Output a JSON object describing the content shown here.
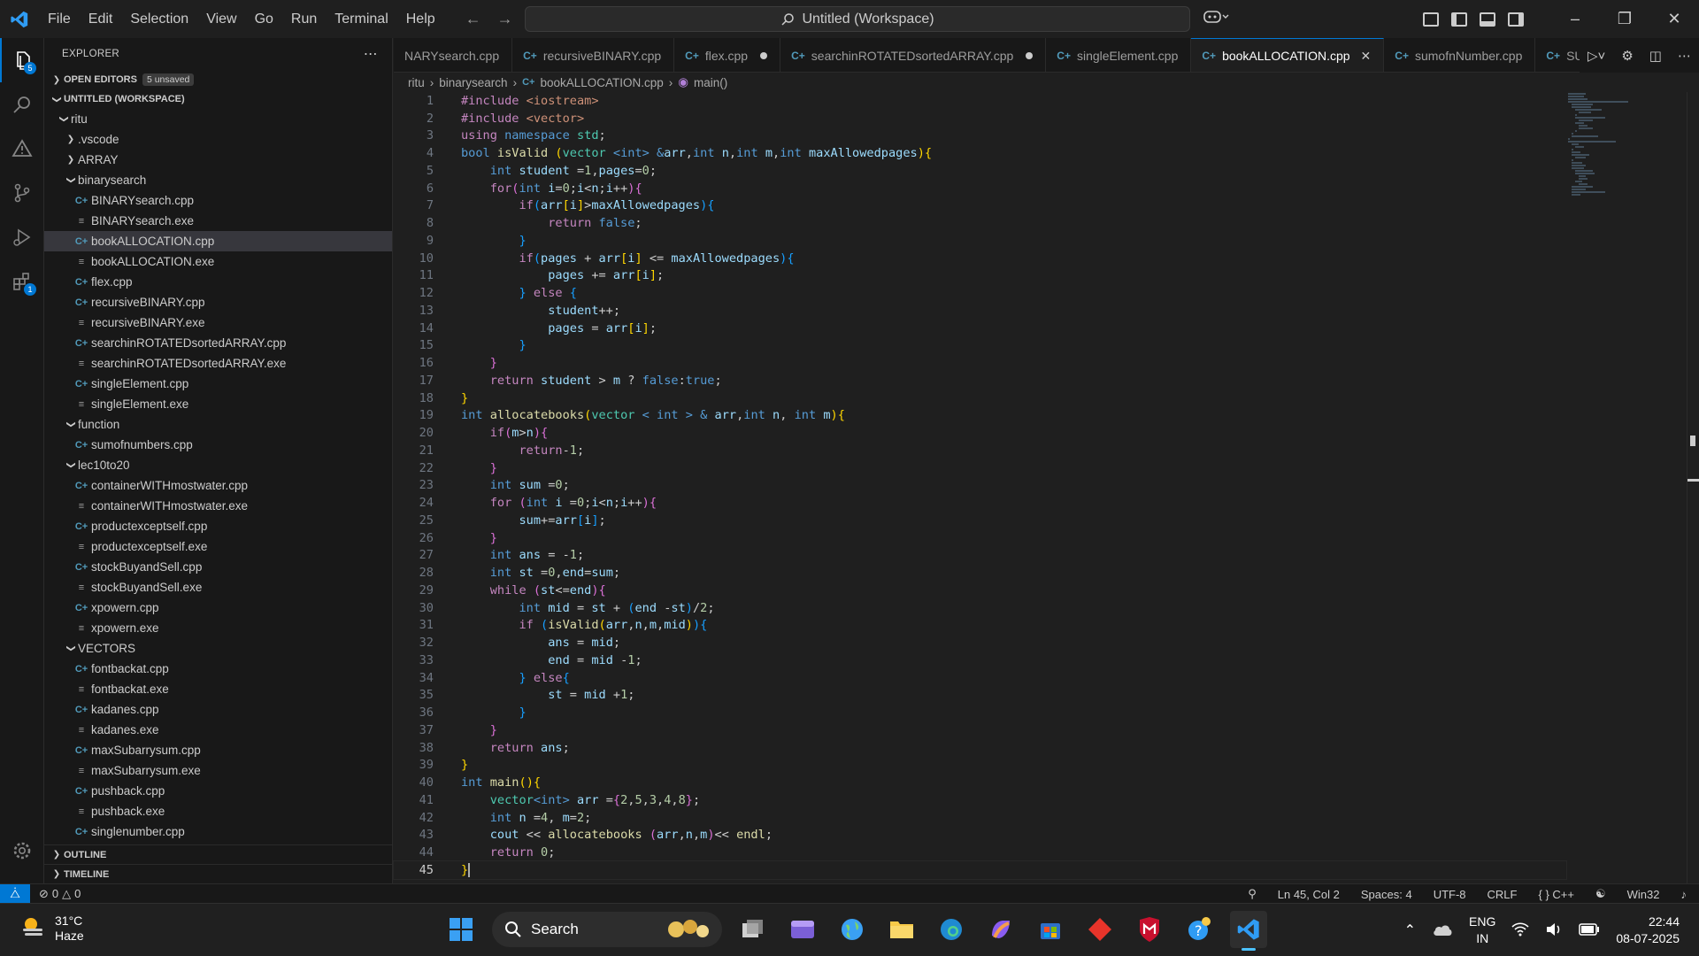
{
  "menu": [
    "File",
    "Edit",
    "Selection",
    "View",
    "Go",
    "Run",
    "Terminal",
    "Help"
  ],
  "command_center": "Untitled (Workspace)",
  "explorer": {
    "title": "EXPLORER",
    "open_editors": "OPEN EDITORS",
    "unsaved_badge": "5 unsaved",
    "workspace": "UNTITLED (WORKSPACE)",
    "outline": "OUTLINE",
    "timeline": "TIMELINE"
  },
  "tree": [
    {
      "label": "ritu",
      "type": "folder-open",
      "depth": 1
    },
    {
      "label": ".vscode",
      "type": "folder",
      "depth": 2
    },
    {
      "label": "ARRAY",
      "type": "folder",
      "depth": 2
    },
    {
      "label": "binarysearch",
      "type": "folder-open",
      "depth": 2
    },
    {
      "label": "BINARYsearch.cpp",
      "type": "cpp",
      "depth": 3
    },
    {
      "label": "BINARYsearch.exe",
      "type": "exe",
      "depth": 3
    },
    {
      "label": "bookALLOCATION.cpp",
      "type": "cpp",
      "depth": 3,
      "selected": true
    },
    {
      "label": "bookALLOCATION.exe",
      "type": "exe",
      "depth": 3
    },
    {
      "label": "flex.cpp",
      "type": "cpp",
      "depth": 3
    },
    {
      "label": "recursiveBINARY.cpp",
      "type": "cpp",
      "depth": 3
    },
    {
      "label": "recursiveBINARY.exe",
      "type": "exe",
      "depth": 3
    },
    {
      "label": "searchinROTATEDsortedARRAY.cpp",
      "type": "cpp",
      "depth": 3
    },
    {
      "label": "searchinROTATEDsortedARRAY.exe",
      "type": "exe",
      "depth": 3
    },
    {
      "label": "singleElement.cpp",
      "type": "cpp",
      "depth": 3
    },
    {
      "label": "singleElement.exe",
      "type": "exe",
      "depth": 3
    },
    {
      "label": "function",
      "type": "folder-open",
      "depth": 2
    },
    {
      "label": "sumofnumbers.cpp",
      "type": "cpp",
      "depth": 3
    },
    {
      "label": "lec10to20",
      "type": "folder-open",
      "depth": 2
    },
    {
      "label": "containerWITHmostwater.cpp",
      "type": "cpp",
      "depth": 3
    },
    {
      "label": "containerWITHmostwater.exe",
      "type": "exe",
      "depth": 3
    },
    {
      "label": "productexceptself.cpp",
      "type": "cpp",
      "depth": 3
    },
    {
      "label": "productexceptself.exe",
      "type": "exe",
      "depth": 3
    },
    {
      "label": "stockBuyandSell.cpp",
      "type": "cpp",
      "depth": 3
    },
    {
      "label": "stockBuyandSell.exe",
      "type": "exe",
      "depth": 3
    },
    {
      "label": "xpowern.cpp",
      "type": "cpp",
      "depth": 3
    },
    {
      "label": "xpowern.exe",
      "type": "exe",
      "depth": 3
    },
    {
      "label": "VECTORS",
      "type": "folder-open",
      "depth": 2
    },
    {
      "label": "fontbackat.cpp",
      "type": "cpp",
      "depth": 3
    },
    {
      "label": "fontbackat.exe",
      "type": "exe",
      "depth": 3
    },
    {
      "label": "kadanes.cpp",
      "type": "cpp",
      "depth": 3
    },
    {
      "label": "kadanes.exe",
      "type": "exe",
      "depth": 3
    },
    {
      "label": "maxSubarrysum.cpp",
      "type": "cpp",
      "depth": 3
    },
    {
      "label": "maxSubarrysum.exe",
      "type": "exe",
      "depth": 3
    },
    {
      "label": "pushback.cpp",
      "type": "cpp",
      "depth": 3
    },
    {
      "label": "pushback.exe",
      "type": "exe",
      "depth": 3
    },
    {
      "label": "singlenumber.cpp",
      "type": "cpp",
      "depth": 3
    }
  ],
  "tabs": [
    {
      "label": "NARYsearch.cpp",
      "dirty": false,
      "active": false
    },
    {
      "label": "recursiveBINARY.cpp",
      "dirty": false,
      "active": false
    },
    {
      "label": "flex.cpp",
      "dirty": true,
      "active": false
    },
    {
      "label": "searchinROTATEDsortedARRAY.cpp",
      "dirty": true,
      "active": false
    },
    {
      "label": "singleElement.cpp",
      "dirty": false,
      "active": false
    },
    {
      "label": "bookALLOCATION.cpp",
      "dirty": false,
      "active": true
    },
    {
      "label": "sumofnNumber.cpp",
      "dirty": false,
      "active": false
    },
    {
      "label": "SUMpas",
      "dirty": false,
      "active": false
    }
  ],
  "breadcrumb": {
    "root": "ritu",
    "folder": "binarysearch",
    "file": "bookALLOCATION.cpp",
    "symbol": "main()"
  },
  "code": [
    [
      [
        "#include ",
        "ctl"
      ],
      [
        "<iostream>",
        "str"
      ]
    ],
    [
      [
        "#include ",
        "ctl"
      ],
      [
        "<vector>",
        "str"
      ]
    ],
    [
      [
        "using ",
        "ctl"
      ],
      [
        "namespace ",
        "kw"
      ],
      [
        "std",
        "typ"
      ],
      [
        ";",
        ""
      ]
    ],
    [
      [
        "bool ",
        "kw"
      ],
      [
        "isValid ",
        "fn"
      ],
      [
        "(",
        "b1"
      ],
      [
        "vector ",
        "typ"
      ],
      [
        "<",
        "kw"
      ],
      [
        "int",
        "kw"
      ],
      [
        "> ",
        "kw"
      ],
      [
        "&",
        "kw"
      ],
      [
        "arr",
        "var"
      ],
      [
        ",",
        ""
      ],
      [
        "int ",
        "kw"
      ],
      [
        "n",
        "var"
      ],
      [
        ",",
        ""
      ],
      [
        "int ",
        "kw"
      ],
      [
        "m",
        "var"
      ],
      [
        ",",
        ""
      ],
      [
        "int ",
        "kw"
      ],
      [
        "maxAllowedpages",
        "var"
      ],
      [
        ")",
        "b1"
      ],
      [
        "{",
        "b1"
      ]
    ],
    [
      [
        "    int ",
        "kw"
      ],
      [
        "student ",
        "var"
      ],
      [
        "=",
        ""
      ],
      [
        "1",
        "num"
      ],
      [
        ",",
        ""
      ],
      [
        "pages",
        "var"
      ],
      [
        "=",
        ""
      ],
      [
        "0",
        "num"
      ],
      [
        ";",
        ""
      ]
    ],
    [
      [
        "    for",
        "ctl"
      ],
      [
        "(",
        "b2"
      ],
      [
        "int ",
        "kw"
      ],
      [
        "i",
        "var"
      ],
      [
        "=",
        ""
      ],
      [
        "0",
        "num"
      ],
      [
        ";",
        ""
      ],
      [
        "i",
        "var"
      ],
      [
        "<",
        ""
      ],
      [
        "n",
        "var"
      ],
      [
        ";",
        ""
      ],
      [
        "i",
        "var"
      ],
      [
        "++",
        ""
      ],
      [
        ")",
        "b2"
      ],
      [
        "{",
        "b2"
      ]
    ],
    [
      [
        "        if",
        "ctl"
      ],
      [
        "(",
        "b3"
      ],
      [
        "arr",
        "var"
      ],
      [
        "[",
        "b1"
      ],
      [
        "i",
        "var"
      ],
      [
        "]",
        "b1"
      ],
      [
        ">",
        ""
      ],
      [
        "maxAllowedpages",
        "var"
      ],
      [
        ")",
        "b3"
      ],
      [
        "{",
        "b3"
      ]
    ],
    [
      [
        "            return ",
        "ctl"
      ],
      [
        "false",
        "kw"
      ],
      [
        ";",
        ""
      ]
    ],
    [
      [
        "        }",
        "b3"
      ]
    ],
    [
      [
        "        if",
        "ctl"
      ],
      [
        "(",
        "b3"
      ],
      [
        "pages ",
        "var"
      ],
      [
        "+ ",
        ""
      ],
      [
        "arr",
        "var"
      ],
      [
        "[",
        "b1"
      ],
      [
        "i",
        "var"
      ],
      [
        "]",
        "b1"
      ],
      [
        " <= ",
        ""
      ],
      [
        "maxAllowedpages",
        "var"
      ],
      [
        ")",
        "b3"
      ],
      [
        "{",
        "b3"
      ]
    ],
    [
      [
        "            pages ",
        "var"
      ],
      [
        "+= ",
        ""
      ],
      [
        "arr",
        "var"
      ],
      [
        "[",
        "b1"
      ],
      [
        "i",
        "var"
      ],
      [
        "]",
        "b1"
      ],
      [
        ";",
        ""
      ]
    ],
    [
      [
        "        } ",
        "b3"
      ],
      [
        "else ",
        "ctl"
      ],
      [
        "{",
        "b3"
      ]
    ],
    [
      [
        "            student",
        "var"
      ],
      [
        "++;",
        ""
      ]
    ],
    [
      [
        "            pages ",
        "var"
      ],
      [
        "= ",
        ""
      ],
      [
        "arr",
        "var"
      ],
      [
        "[",
        "b1"
      ],
      [
        "i",
        "var"
      ],
      [
        "]",
        "b1"
      ],
      [
        ";",
        ""
      ]
    ],
    [
      [
        "        }",
        "b3"
      ]
    ],
    [
      [
        "    }",
        "b2"
      ]
    ],
    [
      [
        "    return ",
        "ctl"
      ],
      [
        "student ",
        "var"
      ],
      [
        "> ",
        ""
      ],
      [
        "m ",
        "var"
      ],
      [
        "? ",
        ""
      ],
      [
        "false",
        "kw"
      ],
      [
        ":",
        ""
      ],
      [
        "true",
        "kw"
      ],
      [
        ";",
        ""
      ]
    ],
    [
      [
        "}",
        "b1"
      ]
    ],
    [
      [
        "int ",
        "kw"
      ],
      [
        "allocatebooks",
        "fn"
      ],
      [
        "(",
        "b1"
      ],
      [
        "vector ",
        "typ"
      ],
      [
        "< ",
        "kw"
      ],
      [
        "int ",
        "kw"
      ],
      [
        "> ",
        "kw"
      ],
      [
        "& ",
        "kw"
      ],
      [
        "arr",
        "var"
      ],
      [
        ",",
        ""
      ],
      [
        "int ",
        "kw"
      ],
      [
        "n",
        "var"
      ],
      [
        ", ",
        ""
      ],
      [
        "int ",
        "kw"
      ],
      [
        "m",
        "var"
      ],
      [
        ")",
        "b1"
      ],
      [
        "{",
        "b1"
      ]
    ],
    [
      [
        "    if",
        "ctl"
      ],
      [
        "(",
        "b2"
      ],
      [
        "m",
        "var"
      ],
      [
        ">",
        ""
      ],
      [
        "n",
        "var"
      ],
      [
        ")",
        "b2"
      ],
      [
        "{",
        "b2"
      ]
    ],
    [
      [
        "        return",
        "ctl"
      ],
      [
        "-",
        ""
      ],
      [
        "1",
        "num"
      ],
      [
        ";",
        ""
      ]
    ],
    [
      [
        "    }",
        "b2"
      ]
    ],
    [
      [
        "    int ",
        "kw"
      ],
      [
        "sum ",
        "var"
      ],
      [
        "=",
        ""
      ],
      [
        "0",
        "num"
      ],
      [
        ";",
        ""
      ]
    ],
    [
      [
        "    for ",
        "ctl"
      ],
      [
        "(",
        "b2"
      ],
      [
        "int ",
        "kw"
      ],
      [
        "i ",
        "var"
      ],
      [
        "=",
        ""
      ],
      [
        "0",
        "num"
      ],
      [
        ";",
        ""
      ],
      [
        "i",
        "var"
      ],
      [
        "<",
        ""
      ],
      [
        "n",
        "var"
      ],
      [
        ";",
        ""
      ],
      [
        "i",
        "var"
      ],
      [
        "++",
        ""
      ],
      [
        ")",
        "b2"
      ],
      [
        "{",
        "b2"
      ]
    ],
    [
      [
        "        sum",
        "var"
      ],
      [
        "+=",
        ""
      ],
      [
        "arr",
        "var"
      ],
      [
        "[",
        "b3"
      ],
      [
        "i",
        "var"
      ],
      [
        "]",
        "b3"
      ],
      [
        ";",
        ""
      ]
    ],
    [
      [
        "    }",
        "b2"
      ]
    ],
    [
      [
        "    int ",
        "kw"
      ],
      [
        "ans ",
        "var"
      ],
      [
        "= -",
        ""
      ],
      [
        "1",
        "num"
      ],
      [
        ";",
        ""
      ]
    ],
    [
      [
        "    int ",
        "kw"
      ],
      [
        "st ",
        "var"
      ],
      [
        "=",
        ""
      ],
      [
        "0",
        "num"
      ],
      [
        ",",
        ""
      ],
      [
        "end",
        "var"
      ],
      [
        "=",
        ""
      ],
      [
        "sum",
        "var"
      ],
      [
        ";",
        ""
      ]
    ],
    [
      [
        "    while ",
        "ctl"
      ],
      [
        "(",
        "b2"
      ],
      [
        "st",
        "var"
      ],
      [
        "<=",
        ""
      ],
      [
        "end",
        "var"
      ],
      [
        ")",
        "b2"
      ],
      [
        "{",
        "b2"
      ]
    ],
    [
      [
        "        int ",
        "kw"
      ],
      [
        "mid ",
        "var"
      ],
      [
        "= ",
        ""
      ],
      [
        "st ",
        "var"
      ],
      [
        "+ ",
        ""
      ],
      [
        "(",
        "b3"
      ],
      [
        "end ",
        "var"
      ],
      [
        "-",
        ""
      ],
      [
        "st",
        "var"
      ],
      [
        ")",
        "b3"
      ],
      [
        "/",
        ""
      ],
      [
        "2",
        "num"
      ],
      [
        ";",
        ""
      ]
    ],
    [
      [
        "        if ",
        "ctl"
      ],
      [
        "(",
        "b3"
      ],
      [
        "isValid",
        "fn"
      ],
      [
        "(",
        "b1"
      ],
      [
        "arr",
        "var"
      ],
      [
        ",",
        ""
      ],
      [
        "n",
        "var"
      ],
      [
        ",",
        ""
      ],
      [
        "m",
        "var"
      ],
      [
        ",",
        ""
      ],
      [
        "mid",
        "var"
      ],
      [
        ")",
        "b1"
      ],
      [
        ")",
        "b3"
      ],
      [
        "{",
        "b3"
      ]
    ],
    [
      [
        "            ans ",
        "var"
      ],
      [
        "= ",
        ""
      ],
      [
        "mid",
        "var"
      ],
      [
        ";",
        ""
      ]
    ],
    [
      [
        "            end ",
        "var"
      ],
      [
        "= ",
        ""
      ],
      [
        "mid ",
        "var"
      ],
      [
        "-",
        ""
      ],
      [
        "1",
        "num"
      ],
      [
        ";",
        ""
      ]
    ],
    [
      [
        "        } ",
        "b3"
      ],
      [
        "else",
        "ctl"
      ],
      [
        "{",
        "b3"
      ]
    ],
    [
      [
        "            st ",
        "var"
      ],
      [
        "= ",
        ""
      ],
      [
        "mid ",
        "var"
      ],
      [
        "+",
        ""
      ],
      [
        "1",
        "num"
      ],
      [
        ";",
        ""
      ]
    ],
    [
      [
        "        }",
        "b3"
      ]
    ],
    [
      [
        "    }",
        "b2"
      ]
    ],
    [
      [
        "    return ",
        "ctl"
      ],
      [
        "ans",
        "var"
      ],
      [
        ";",
        ""
      ]
    ],
    [
      [
        "}",
        "b1"
      ]
    ],
    [
      [
        "int ",
        "kw"
      ],
      [
        "main",
        "fn"
      ],
      [
        "(",
        "b1"
      ],
      [
        ")",
        "b1"
      ],
      [
        "{",
        "b1"
      ]
    ],
    [
      [
        "    vector",
        "typ"
      ],
      [
        "<",
        "kw"
      ],
      [
        "int",
        "kw"
      ],
      [
        "> ",
        "kw"
      ],
      [
        "arr ",
        "var"
      ],
      [
        "=",
        ""
      ],
      [
        "{",
        "b2"
      ],
      [
        "2",
        "num"
      ],
      [
        ",",
        ""
      ],
      [
        "5",
        "num"
      ],
      [
        ",",
        ""
      ],
      [
        "3",
        "num"
      ],
      [
        ",",
        ""
      ],
      [
        "4",
        "num"
      ],
      [
        ",",
        ""
      ],
      [
        "8",
        "num"
      ],
      [
        "}",
        "b2"
      ],
      [
        ";",
        ""
      ]
    ],
    [
      [
        "    int ",
        "kw"
      ],
      [
        "n ",
        "var"
      ],
      [
        "=",
        ""
      ],
      [
        "4",
        "num"
      ],
      [
        ", ",
        ""
      ],
      [
        "m",
        "var"
      ],
      [
        "=",
        ""
      ],
      [
        "2",
        "num"
      ],
      [
        ";",
        ""
      ]
    ],
    [
      [
        "    cout ",
        "var"
      ],
      [
        "<< ",
        ""
      ],
      [
        "allocatebooks ",
        "fn"
      ],
      [
        "(",
        "b2"
      ],
      [
        "arr",
        "var"
      ],
      [
        ",",
        ""
      ],
      [
        "n",
        "var"
      ],
      [
        ",",
        ""
      ],
      [
        "m",
        "var"
      ],
      [
        ")",
        "b2"
      ],
      [
        "<< ",
        ""
      ],
      [
        "endl",
        "fn"
      ],
      [
        ";",
        ""
      ]
    ],
    [
      [
        "    return ",
        "ctl"
      ],
      [
        "0",
        "num"
      ],
      [
        ";",
        ""
      ]
    ],
    [
      [
        "}",
        "b1"
      ]
    ]
  ],
  "current_line": 45,
  "status": {
    "errors": "0",
    "warnings": "0",
    "position": "Ln 45, Col 2",
    "spaces": "Spaces: 4",
    "encoding": "UTF-8",
    "eol": "CRLF",
    "language": "C++",
    "platform": "Win32"
  },
  "taskbar": {
    "temperature": "31°C",
    "condition": "Haze",
    "search": "Search",
    "lang_top": "ENG",
    "lang_bottom": "IN",
    "time": "22:44",
    "date": "08-07-2025"
  },
  "colors": {
    "accent": "#0078d4",
    "editor_bg": "#1f1f1f",
    "sidebar_bg": "#181818"
  }
}
